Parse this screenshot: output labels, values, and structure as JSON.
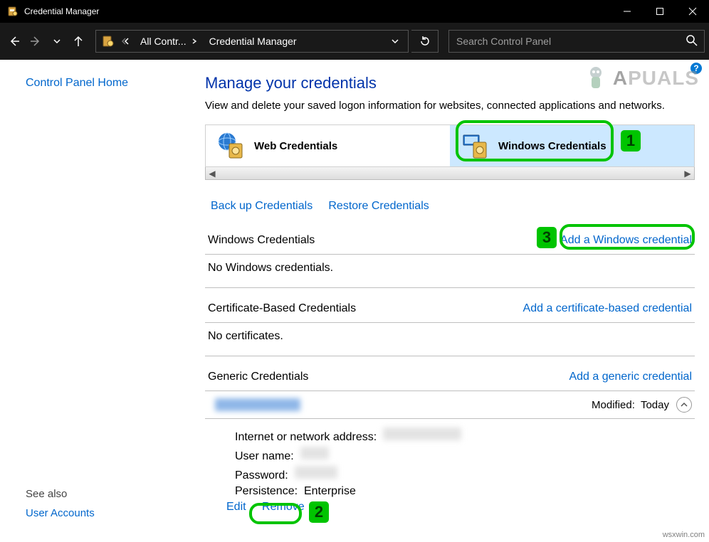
{
  "window": {
    "title": "Credential Manager"
  },
  "toolbar": {
    "breadcrumb": {
      "root_icon": "safe-icon",
      "seg1": "All Contr...",
      "seg2": "Credential Manager"
    },
    "search_placeholder": "Search Control Panel"
  },
  "sidebar": {
    "home": "Control Panel Home",
    "see_also": "See also",
    "user_accounts": "User Accounts"
  },
  "main": {
    "heading": "Manage your credentials",
    "subtitle": "View and delete your saved logon information for websites, connected applications and networks.",
    "categories": {
      "web": "Web Credentials",
      "windows": "Windows Credentials"
    },
    "backup": "Back up Credentials",
    "restore": "Restore Credentials",
    "sections": {
      "win": {
        "title": "Windows Credentials",
        "add": "Add a Windows credential",
        "empty": "No Windows credentials."
      },
      "cert": {
        "title": "Certificate-Based Credentials",
        "add": "Add a certificate-based credential",
        "empty": "No certificates."
      },
      "gen": {
        "title": "Generic Credentials",
        "add": "Add a generic credential"
      }
    },
    "entry": {
      "modified_label": "Modified:",
      "modified_value": "Today",
      "addr_label": "Internet or network address:",
      "user_label": "User name:",
      "pass_label": "Password:",
      "persist_label": "Persistence:",
      "persist_value": "Enterprise",
      "edit": "Edit",
      "remove": "Remove"
    }
  },
  "annotations": {
    "n1": "1",
    "n2": "2",
    "n3": "3"
  },
  "watermark_brand": "A",
  "watermark_brand2": "PUALS",
  "watermark": "wsxwin.com"
}
